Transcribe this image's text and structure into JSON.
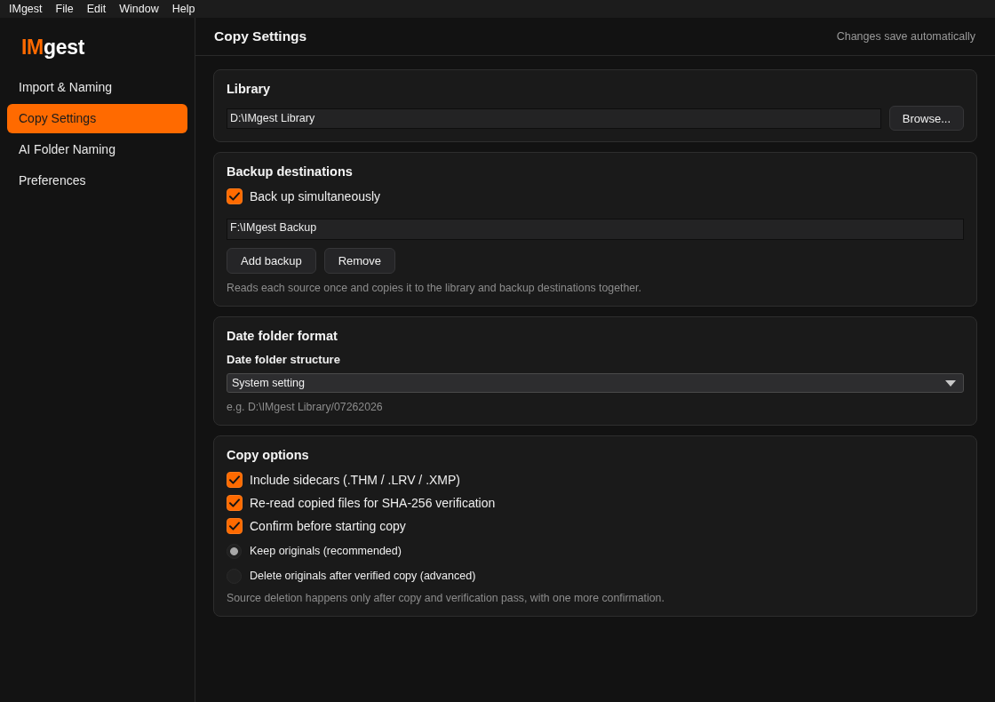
{
  "menu_bar": {
    "items": [
      "IMgest",
      "File",
      "Edit",
      "Window",
      "Help"
    ]
  },
  "sidebar": {
    "logo": {
      "accent": "IM",
      "text": "gest"
    },
    "items": [
      {
        "label": "Import & Naming",
        "selected": false
      },
      {
        "label": "Copy Settings",
        "selected": true
      },
      {
        "label": "AI Folder Naming",
        "selected": false
      },
      {
        "label": "Preferences",
        "selected": false
      }
    ]
  },
  "header": {
    "title": "Copy Settings",
    "status": "Changes save automatically"
  },
  "sections": [
    {
      "title": "Library",
      "rows": [
        {
          "kind": "path",
          "value": "D:\\IMgest Library",
          "button": "Browse..."
        }
      ]
    },
    {
      "title": "Backup destinations",
      "rows": [
        {
          "kind": "checkbox",
          "label": "Back up simultaneously",
          "checked": true
        },
        {
          "kind": "field",
          "value": "F:\\IMgest Backup"
        },
        {
          "kind": "buttons",
          "buttons": [
            "Add backup",
            "Remove"
          ]
        },
        {
          "kind": "hint",
          "text": "Reads each source once and copies it to the library and backup destinations together."
        }
      ]
    },
    {
      "title": "Date folder format",
      "rows": [
        {
          "kind": "label",
          "text": "Date folder structure"
        },
        {
          "kind": "select",
          "value": "System setting"
        },
        {
          "kind": "hint",
          "text": "e.g. D:\\IMgest Library/07262026"
        }
      ]
    },
    {
      "title": "Copy options",
      "rows": [
        {
          "kind": "checkbox",
          "label": "Include sidecars (.THM / .LRV / .XMP)",
          "checked": true
        },
        {
          "kind": "checkbox",
          "label": "Re-read copied files for SHA-256 verification",
          "checked": true
        },
        {
          "kind": "checkbox",
          "label": "Confirm before starting copy",
          "checked": true
        },
        {
          "kind": "radio",
          "label": "Keep originals (recommended)",
          "selected": true
        },
        {
          "kind": "radio",
          "label": "Delete originals after verified copy (advanced)",
          "selected": false
        },
        {
          "kind": "hint",
          "text": "Source deletion happens only after copy and verification pass, with one more confirmation."
        }
      ]
    }
  ]
}
